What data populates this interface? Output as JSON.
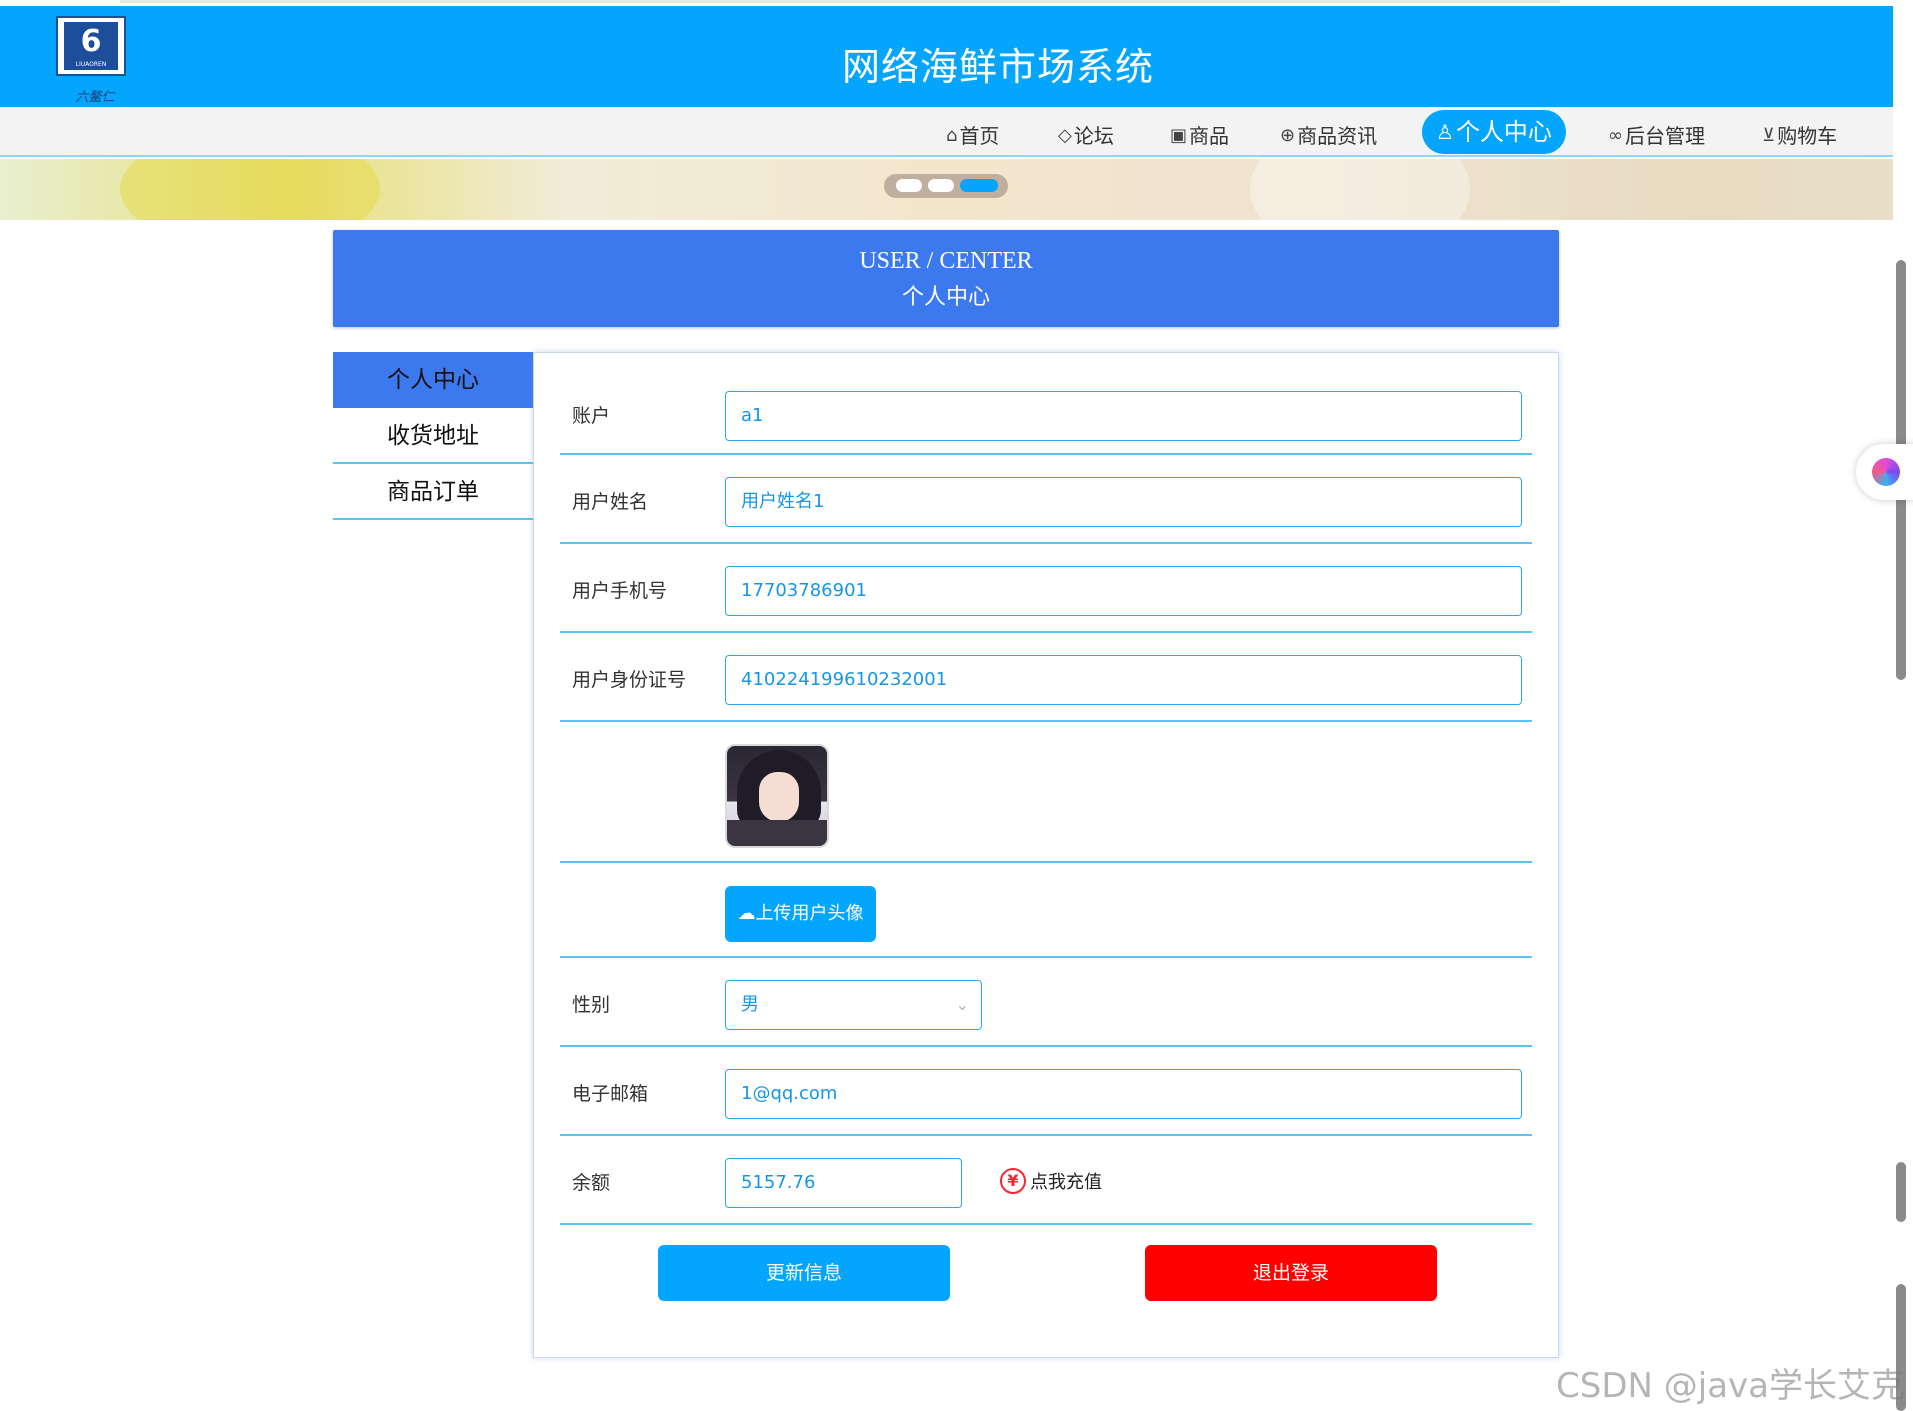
{
  "header": {
    "site_title": "网络海鲜市场系统",
    "logo_text": "LIUAOREN",
    "logo_glyph": "6",
    "logo_sub": "六鳌仁"
  },
  "nav": {
    "items": [
      {
        "icon": "home-icon",
        "glyph": "⌂",
        "label": "首页"
      },
      {
        "icon": "tag-icon",
        "glyph": "◇",
        "label": "论坛"
      },
      {
        "icon": "gift-icon",
        "glyph": "▣",
        "label": "商品"
      },
      {
        "icon": "globe-icon",
        "glyph": "⊕",
        "label": "商品资讯"
      },
      {
        "icon": "user-icon",
        "glyph": "♙",
        "label": "个人中心",
        "active": true
      },
      {
        "icon": "link-icon",
        "glyph": "∞",
        "label": "后台管理"
      },
      {
        "icon": "cart-icon",
        "glyph": "⊻",
        "label": "购物车"
      }
    ],
    "active_color": "#04a5fd"
  },
  "banner": {
    "slides": 3,
    "active_slide": 3
  },
  "title_box": {
    "en": "USER / CENTER",
    "cn": "个人中心"
  },
  "side_menu": {
    "items": [
      "个人中心",
      "收货地址",
      "商品订单"
    ],
    "active": "个人中心"
  },
  "form": {
    "account": {
      "label": "账户",
      "value": "a1"
    },
    "username": {
      "label": "用户姓名",
      "value": "用户姓名1"
    },
    "phone": {
      "label": "用户手机号",
      "value": "17703786901"
    },
    "id_card": {
      "label": "用户身份证号",
      "value": "410224199610232001"
    },
    "upload_button": "上传用户头像",
    "gender": {
      "label": "性别",
      "value": "男"
    },
    "email": {
      "label": "电子邮箱",
      "value": "1@qq.com"
    },
    "balance": {
      "label": "余额",
      "value": "5157.76",
      "recharge": "点我充值"
    },
    "update_button": "更新信息",
    "logout_button": "退出登录"
  },
  "watermark": "CSDN @java学长艾克",
  "colors": {
    "primary": "#04a5fd",
    "title_blue": "#3c79ef",
    "danger": "#ff0000"
  }
}
